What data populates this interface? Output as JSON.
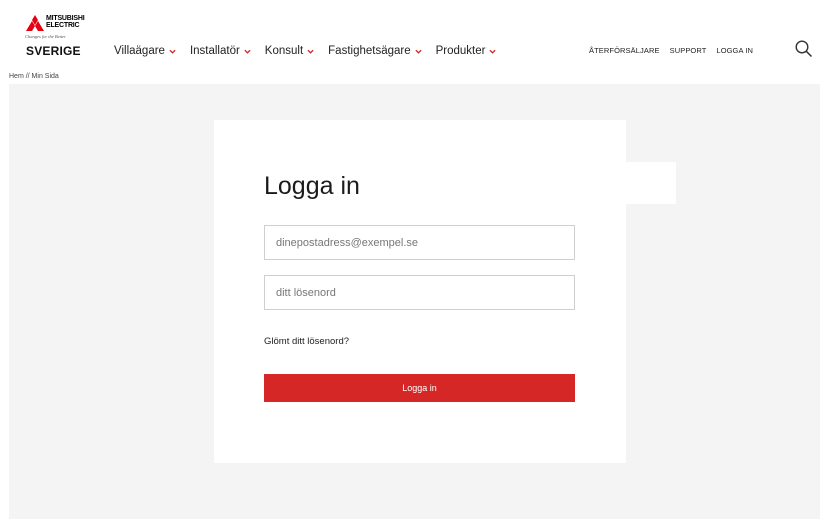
{
  "brand": {
    "wordmark_line1": "MITSUBISHI",
    "wordmark_line2": "ELECTRIC",
    "tagline": "Changes for the Better",
    "country": "SVERIGE",
    "brand_color": "#e60012"
  },
  "nav": {
    "items": [
      {
        "label": "Villaägare"
      },
      {
        "label": "Installatör"
      },
      {
        "label": "Konsult"
      },
      {
        "label": "Fastighetsägare"
      },
      {
        "label": "Produkter"
      }
    ],
    "chevron_color": "#d42726"
  },
  "utility": {
    "items": [
      {
        "label": "ÅTERFÖRSÄLJARE"
      },
      {
        "label": "SUPPORT"
      },
      {
        "label": "LOGGA IN"
      }
    ],
    "search_icon": "search-icon"
  },
  "breadcrumb": {
    "text": "Hem // Min Sida"
  },
  "login": {
    "title": "Logga in",
    "email_placeholder": "dinepostadress@exempel.se",
    "email_value": "",
    "password_placeholder": "ditt lösenord",
    "password_value": "",
    "forgot_label": "Glömt ditt lösenord?",
    "submit_label": "Logga in",
    "submit_color": "#d42726"
  }
}
